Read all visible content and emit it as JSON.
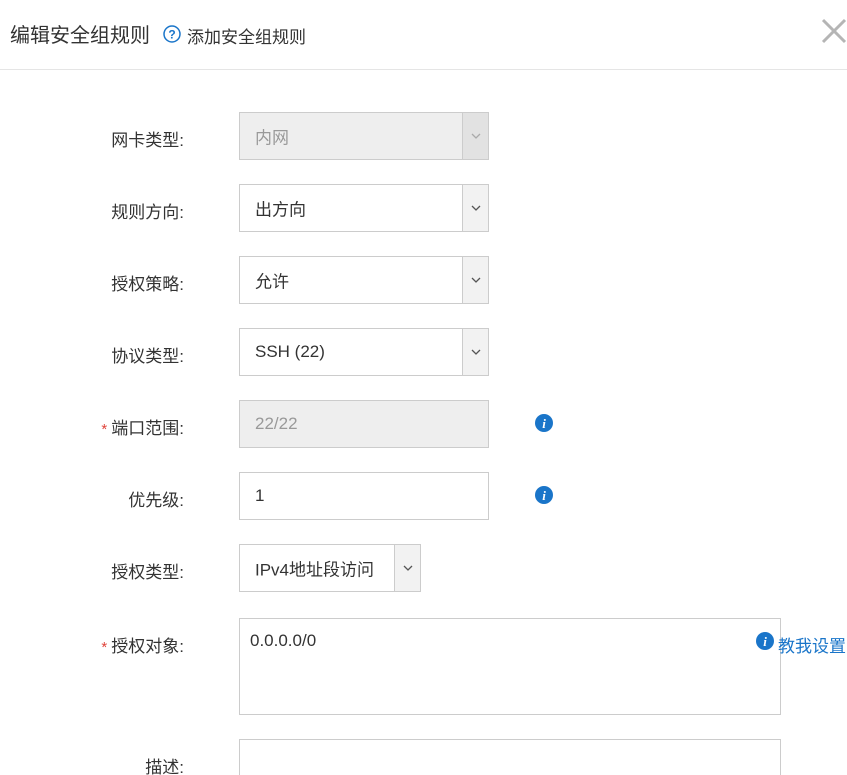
{
  "header": {
    "title": "编辑安全组规则",
    "help_link": "添加安全组规则"
  },
  "form": {
    "nic_type": {
      "label": "网卡类型:",
      "value": "内网"
    },
    "direction": {
      "label": "规则方向:",
      "value": "出方向"
    },
    "policy": {
      "label": "授权策略:",
      "value": "允许"
    },
    "protocol": {
      "label": "协议类型:",
      "value": "SSH (22)"
    },
    "port_range": {
      "label": "端口范围:",
      "required_mark": "*",
      "value": "22/22"
    },
    "priority": {
      "label": "优先级:",
      "value": "1"
    },
    "auth_type": {
      "label": "授权类型:",
      "value": "IPv4地址段访问"
    },
    "auth_object": {
      "label": "授权对象:",
      "required_mark": "*",
      "value": "0.0.0.0/0",
      "teach_link": "教我设置"
    },
    "description": {
      "label": "描述:",
      "value": ""
    }
  },
  "colors": {
    "accent": "#1a75c9",
    "required": "#e0443b",
    "disabled_bg": "#eeeeee"
  }
}
